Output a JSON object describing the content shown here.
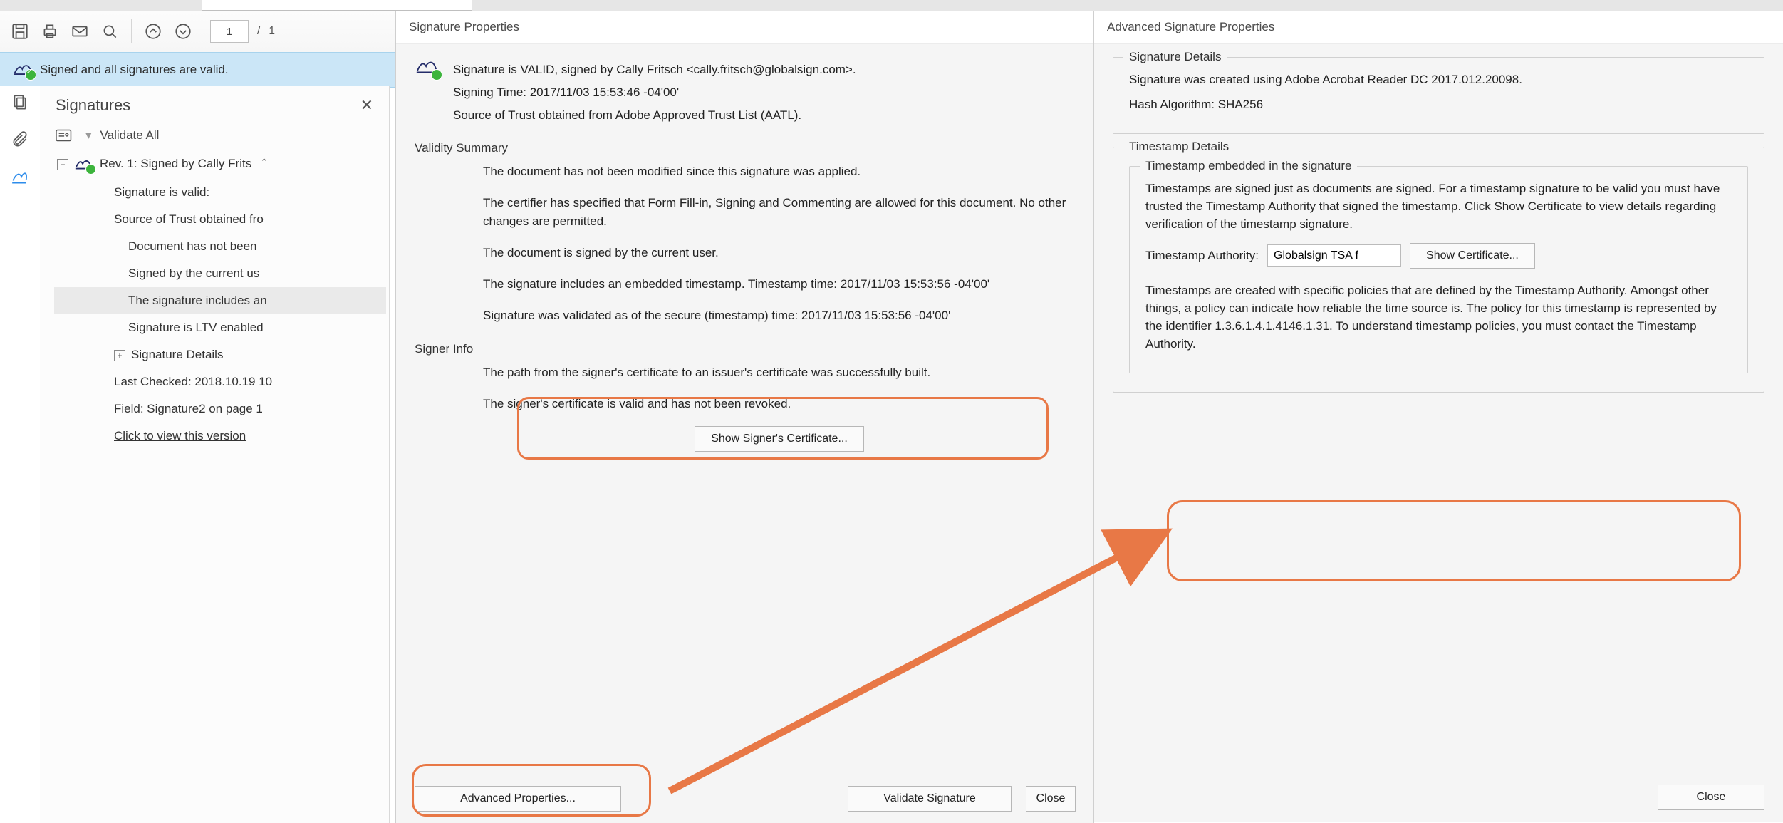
{
  "toolbar": {
    "current_page": "1",
    "page_sep": "/",
    "total_pages": "1"
  },
  "banner": {
    "text": "Signed and all signatures are valid."
  },
  "side": {
    "title": "Signatures",
    "validate_all": "Validate All",
    "rev_line": "Rev. 1: Signed by Cally Frits",
    "items": {
      "valid": "Signature is valid:",
      "trust": "Source of Trust obtained fro",
      "not_modified": "Document has not been",
      "current_user": "Signed by the current us",
      "embedded_ts": "The signature includes an",
      "ltv": "Signature is LTV enabled",
      "details": "Signature Details",
      "last_checked": "Last Checked: 2018.10.19 10",
      "field": "Field: Signature2 on page 1",
      "view_version": "Click to view this version"
    }
  },
  "dialog1": {
    "title": "Signature Properties",
    "line_valid": "Signature is VALID, signed by Cally Fritsch <cally.fritsch@globalsign.com>.",
    "line_time": "Signing Time:  2017/11/03 15:53:46 -04'00'",
    "line_trust": "Source of Trust obtained from Adobe Approved Trust List (AATL).",
    "validity_summary": "Validity Summary",
    "v1": "The document has not been modified since this signature was applied.",
    "v2": "The certifier has specified that Form Fill-in, Signing and Commenting are allowed for this document. No other changes are permitted.",
    "v3": "The document is signed by the current user.",
    "v4": "The signature includes an embedded timestamp. Timestamp time: 2017/11/03 15:53:56 -04'00'",
    "v5": "Signature was validated as of the secure (timestamp) time: 2017/11/03 15:53:56 -04'00'",
    "signer_info": "Signer Info",
    "s1": "The path from the signer's certificate to an issuer's certificate was successfully built.",
    "s2": "The signer's certificate is valid and has not been revoked.",
    "btn_show_cert": "Show Signer's Certificate...",
    "btn_adv": "Advanced Properties...",
    "btn_validate": "Validate Signature",
    "btn_close": "Close"
  },
  "dialog2": {
    "title": "Advanced Signature Properties",
    "sig_details": "Signature Details",
    "sd1": "Signature was created using Adobe Acrobat Reader DC 2017.012.20098.",
    "sd2": "Hash Algorithm: SHA256",
    "ts_details": "Timestamp Details",
    "ts_sub": "Timestamp embedded in the signature",
    "ts_para1": "Timestamps are signed just as documents are signed. For a timestamp signature to be valid you must have trusted the Timestamp Authority that signed the timestamp. Click Show Certificate to view details regarding verification of the timestamp signature.",
    "ta_label": "Timestamp Authority:",
    "ta_value": "Globalsign TSA f",
    "btn_show_cert": "Show Certificate...",
    "ts_para2": "Timestamps are created with specific policies that are defined by the Timestamp Authority. Amongst other things, a policy can indicate how reliable the time source is. The policy for this timestamp is represented by the identifier 1.3.6.1.4.1.4146.1.31. To understand timestamp policies, you must contact the Timestamp Authority.",
    "btn_close": "Close"
  }
}
